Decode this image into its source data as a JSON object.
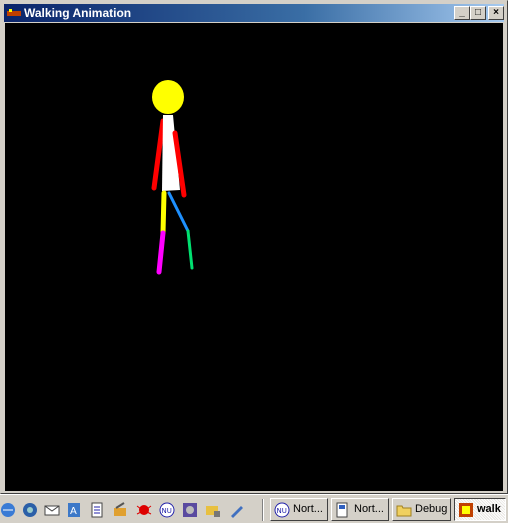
{
  "window": {
    "title": "Walking Animation",
    "minimize_label": "_",
    "maximize_label": "□",
    "close_label": "×"
  },
  "figure": {
    "colors": {
      "head": "#ffff00",
      "torso": "#ffffff",
      "arm": "#ff0000",
      "thigh_front": "#ffff00",
      "shin_front": "#ff00ff",
      "thigh_back": "#1e90ff",
      "shin_back": "#00e070"
    }
  },
  "taskbar": {
    "quick_launch_icons": [
      "desktop-icon",
      "ie-icon",
      "outlook-icon",
      "address-icon",
      "notepad-icon",
      "tool-icon",
      "bug-icon",
      "nu-icon",
      "media-icon",
      "folder-lock-icon",
      "pen-icon"
    ],
    "tasks": [
      {
        "label": "Nort...",
        "icon": "nu-icon",
        "active": false
      },
      {
        "label": "Nort...",
        "icon": "doc-icon",
        "active": false
      },
      {
        "label": "Debug",
        "icon": "folder-icon",
        "active": false
      },
      {
        "label": "walk",
        "icon": "app-icon",
        "active": true
      }
    ]
  }
}
